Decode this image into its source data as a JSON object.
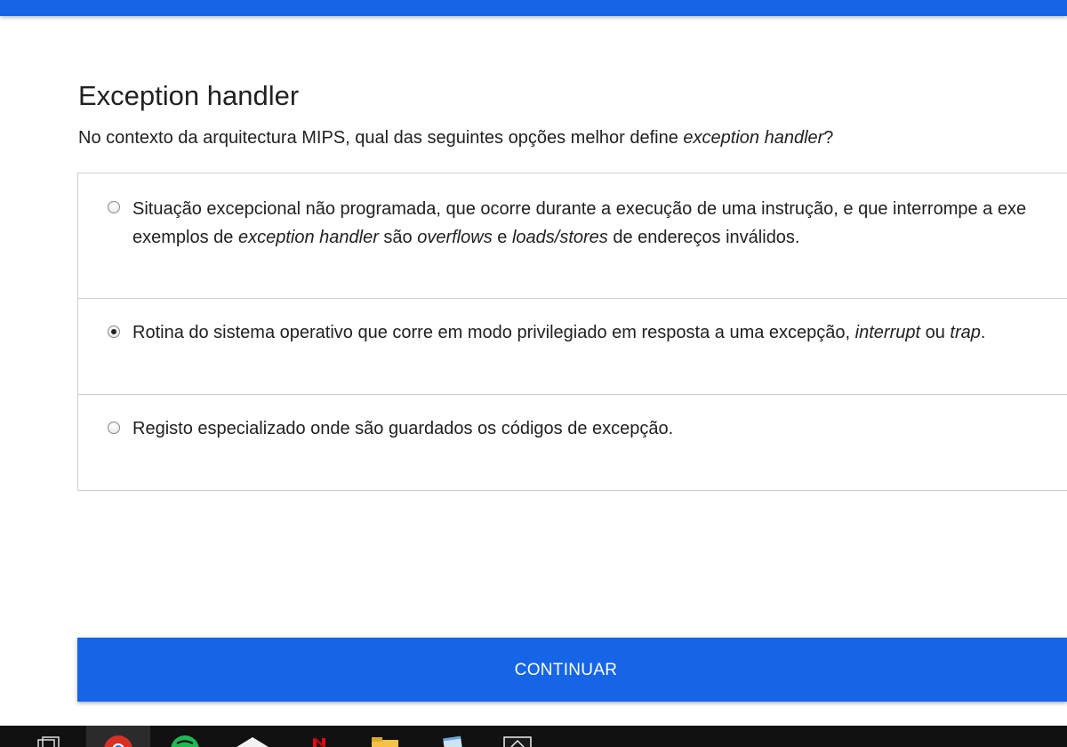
{
  "quiz": {
    "title": "Exception handler",
    "question": {
      "prefix": "No contexto da arquitectura MIPS, qual das seguintes opções melhor define ",
      "term": "exception handler",
      "suffix": "?"
    },
    "options": [
      {
        "selected": false,
        "line1": "Situação excepcional não programada, que ocorre durante a execução de uma instrução, e que interrompe a exe",
        "line2_parts": [
          "exemplos de ",
          "exception handler",
          " são ",
          "overflows",
          " e ",
          "loads/stores",
          " de endereços inválidos."
        ]
      },
      {
        "selected": true,
        "parts": [
          "Rotina do sistema operativo que corre em modo privilegiado em resposta a uma excepção, ",
          "interrupt",
          " ou ",
          "trap",
          "."
        ]
      },
      {
        "selected": false,
        "text": "Registo especializado onde são guardados os códigos de excepção."
      }
    ],
    "continue_label": "CONTINUAR"
  },
  "colors": {
    "accent": "#1565e6",
    "taskbar": "#111111"
  },
  "taskbar": {
    "icons": [
      "task-view-icon",
      "chrome-icon",
      "spotify-icon",
      "app-icon",
      "netflix-icon",
      "file-explorer-icon",
      "notepad-icon",
      "photos-icon"
    ]
  }
}
